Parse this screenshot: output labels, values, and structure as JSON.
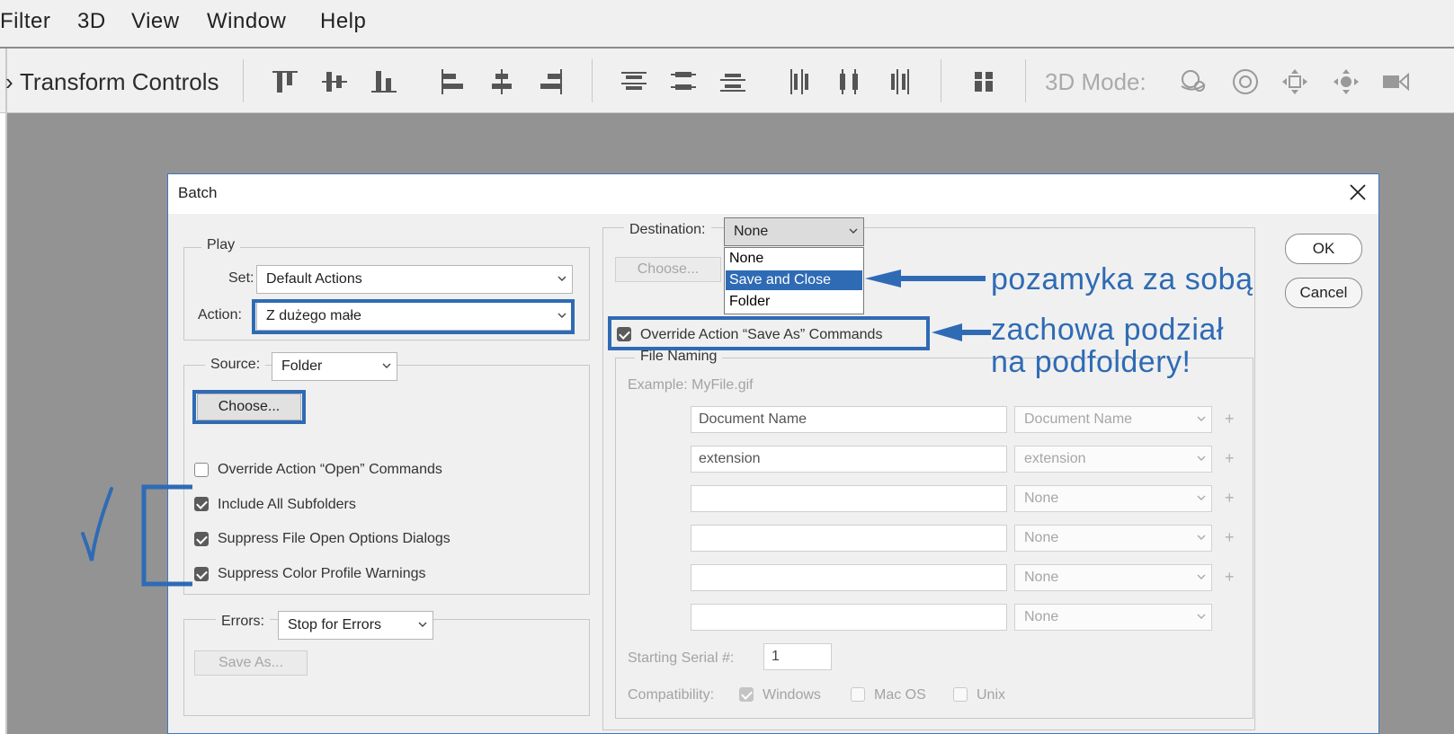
{
  "menubar": {
    "items": [
      "Filter",
      "3D",
      "View",
      "Window",
      "Help"
    ]
  },
  "optionsbar": {
    "transform_label": "Transform Controls",
    "mode_label": "3D Mode:",
    "icons": [
      "align-top-icon",
      "align-vertical-center-icon",
      "align-bottom-icon",
      "align-left-icon",
      "align-horizontal-center-icon",
      "align-right-icon",
      "distribute-top-icon",
      "distribute-vertical-center-icon",
      "distribute-bottom-icon",
      "distribute-left-icon",
      "distribute-horizontal-center-icon",
      "distribute-right-icon",
      "auto-align-icon",
      "orbit-3d-icon",
      "roll-3d-icon",
      "pan-3d-icon",
      "slide-3d-icon",
      "scale-3d-icon"
    ]
  },
  "dialog": {
    "title": "Batch",
    "ok_label": "OK",
    "cancel_label": "Cancel",
    "play": {
      "legend": "Play",
      "set_label": "Set:",
      "set_value": "Default Actions",
      "action_label": "Action:",
      "action_value": "Z dużego małe"
    },
    "source": {
      "label": "Source:",
      "value": "Folder",
      "choose_label": "Choose...",
      "options": [
        {
          "label": "Override Action “Open” Commands",
          "checked": false
        },
        {
          "label": "Include All Subfolders",
          "checked": true
        },
        {
          "label": "Suppress File Open Options Dialogs",
          "checked": true
        },
        {
          "label": "Suppress Color Profile Warnings",
          "checked": true
        }
      ]
    },
    "errors": {
      "label": "Errors:",
      "value": "Stop for Errors",
      "save_as_label": "Save As..."
    },
    "destination": {
      "label": "Destination:",
      "value": "None",
      "choose_label": "Choose...",
      "dropdown_options": [
        "None",
        "Save and Close",
        "Folder"
      ],
      "selected_option": "Save and Close",
      "override_label": "Override Action “Save As” Commands",
      "override_checked": true
    },
    "file_naming": {
      "legend": "File Naming",
      "example": "Example: MyFile.gif",
      "rows": [
        {
          "text": "Document Name",
          "select": "Document Name",
          "plus": "+"
        },
        {
          "text": "extension",
          "select": "extension",
          "plus": "+"
        },
        {
          "text": "",
          "select": "None",
          "plus": "+"
        },
        {
          "text": "",
          "select": "None",
          "plus": "+"
        },
        {
          "text": "",
          "select": "None",
          "plus": "+"
        },
        {
          "text": "",
          "select": "None",
          "plus": ""
        }
      ],
      "serial_label": "Starting Serial #:",
      "serial_value": "1",
      "compat_label": "Compatibility:",
      "compat": [
        {
          "label": "Windows",
          "checked": true
        },
        {
          "label": "Mac OS",
          "checked": false
        },
        {
          "label": "Unix",
          "checked": false
        }
      ]
    }
  },
  "annotations": {
    "save_close_note": "pozamyka za sobą",
    "override_note_line1": "zachowa podział",
    "override_note_line2": "na podfoldery!",
    "color": "#2f6bb5"
  }
}
